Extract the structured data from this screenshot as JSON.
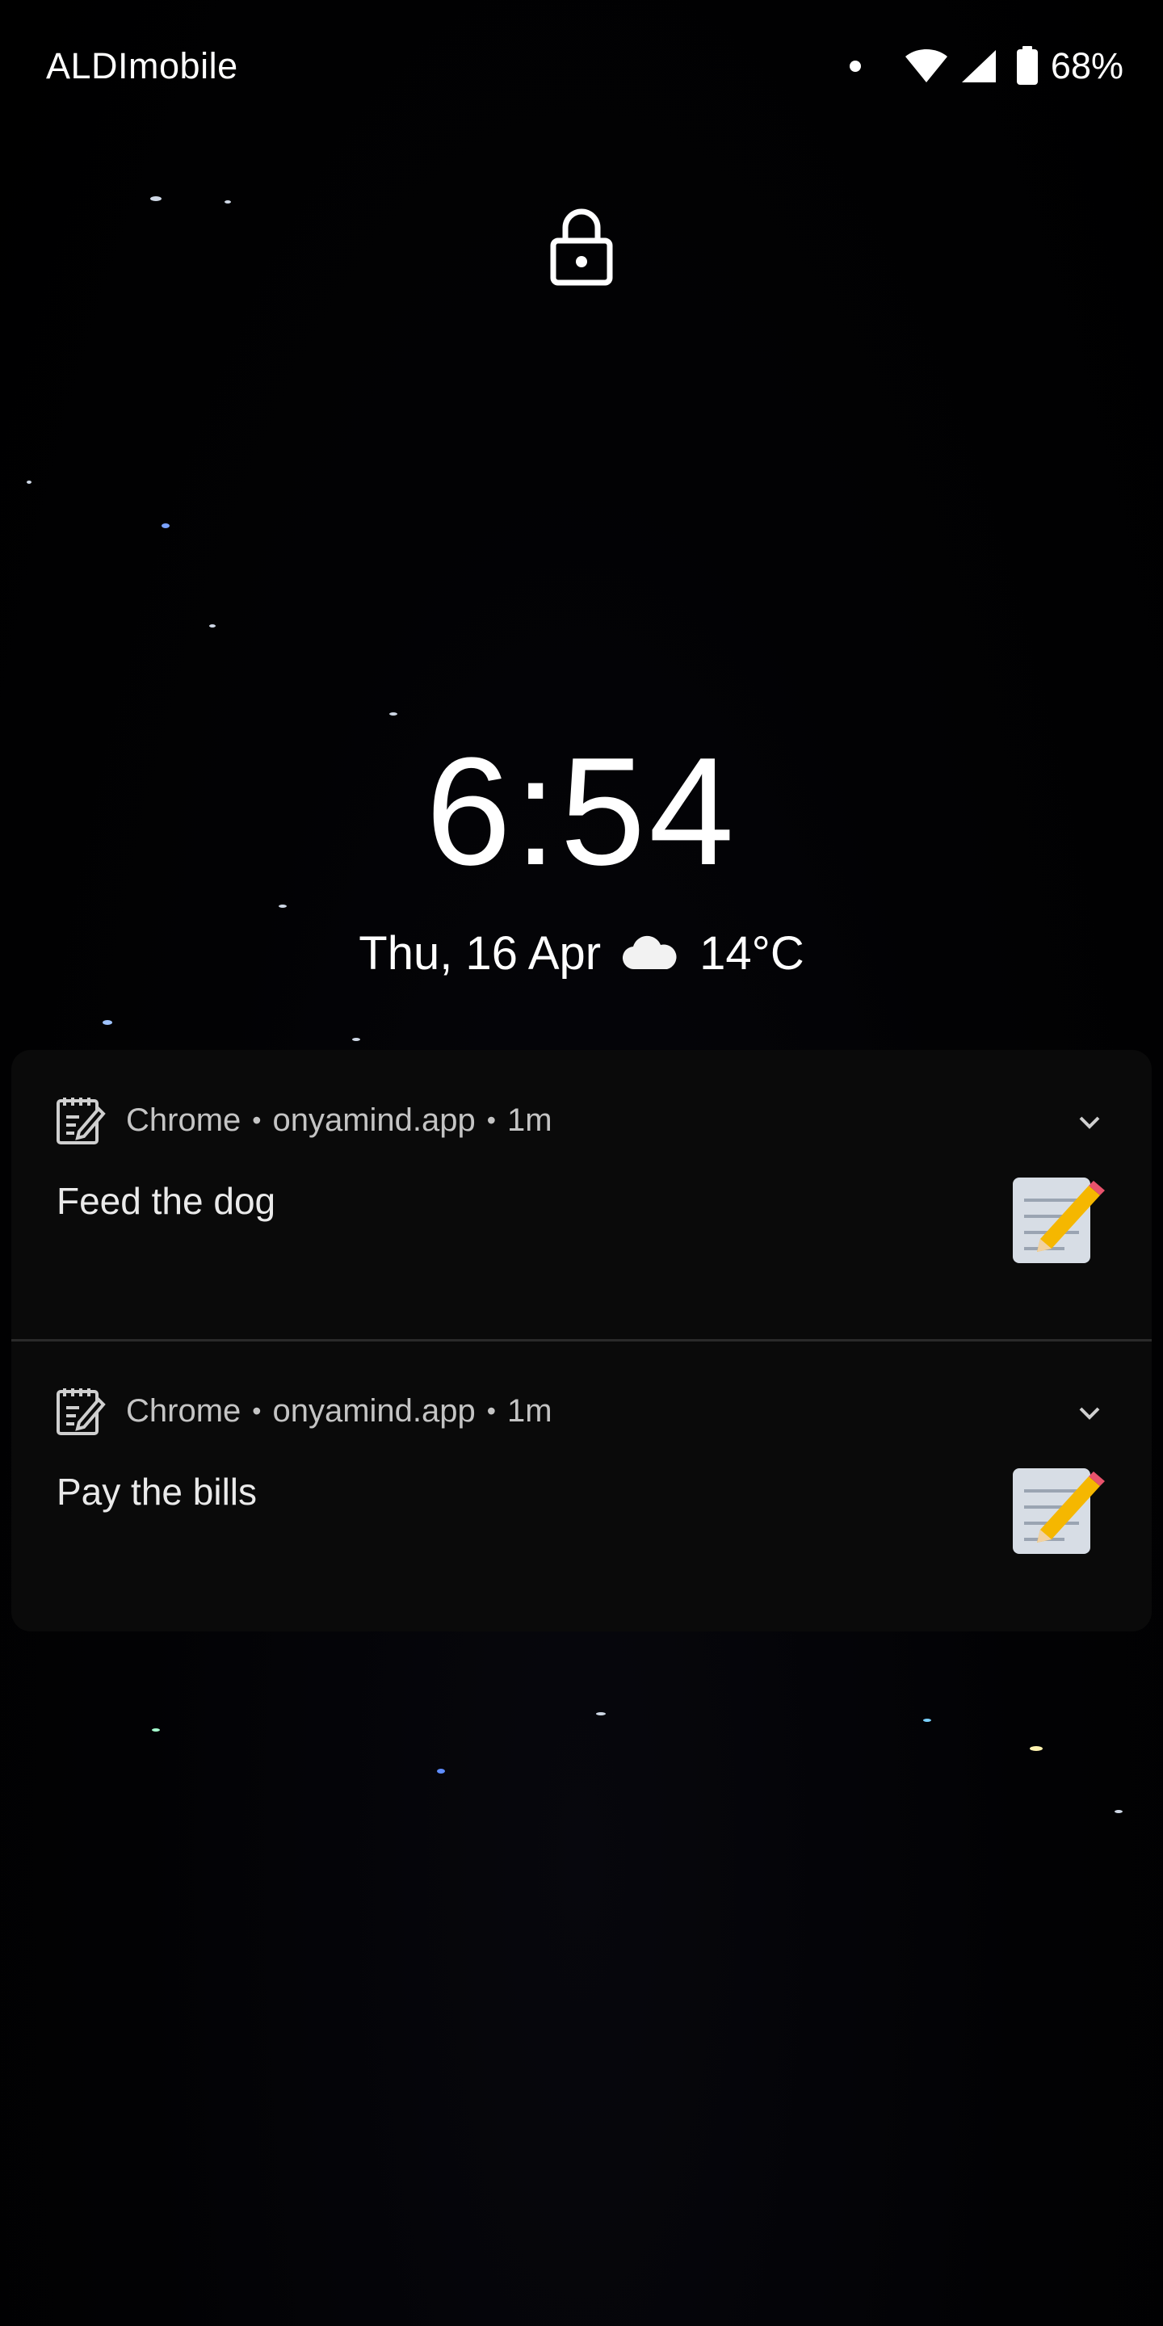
{
  "status_bar": {
    "carrier": "ALDImobile",
    "battery_percent": "68%",
    "icons": [
      "notification-dot-icon",
      "wifi-icon",
      "cellular-signal-icon",
      "battery-icon"
    ]
  },
  "lock_screen": {
    "lock_icon": "lock-icon",
    "time": "6:54",
    "date": "Thu, 16 Apr",
    "weather_icon": "cloud-icon",
    "temperature": "14°C"
  },
  "notifications": [
    {
      "app": "Chrome",
      "source": "onyamind.app",
      "time_ago": "1m",
      "title": "Feed the dog",
      "icon": "memo-icon"
    },
    {
      "app": "Chrome",
      "source": "onyamind.app",
      "time_ago": "1m",
      "title": "Pay the bills",
      "icon": "memo-icon"
    }
  ],
  "colors": {
    "background": "#000000",
    "notification_bg": "#0a0a0a",
    "text_primary": "#ffffff",
    "text_secondary": "#c4c4c4"
  }
}
